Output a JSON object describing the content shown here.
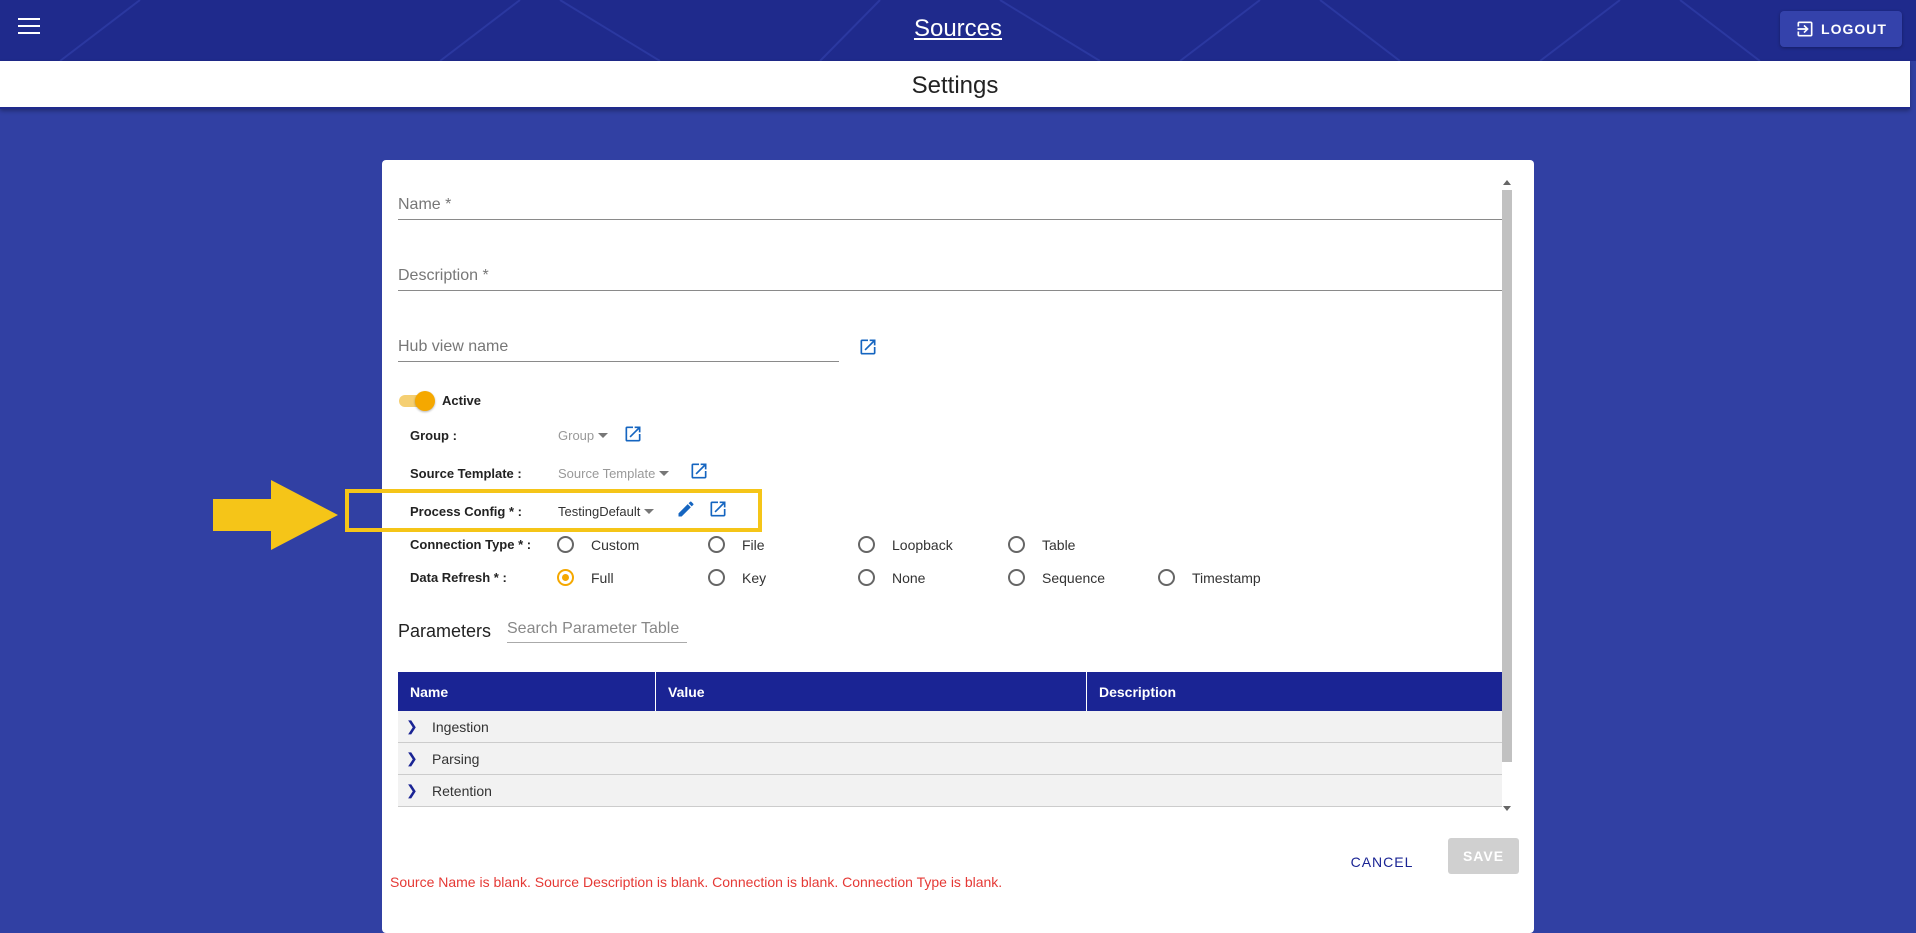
{
  "header": {
    "title": "Sources",
    "logout_label": "LOGOUT"
  },
  "page": {
    "title": "Settings"
  },
  "form": {
    "name_placeholder": "Name *",
    "description_placeholder": "Description *",
    "hub_view_placeholder": "Hub view name",
    "active_label": "Active",
    "active_on": true,
    "group_label": "Group :",
    "group_value": "Group",
    "source_template_label": "Source Template :",
    "source_template_value": "Source Template",
    "process_config_label": "Process Config * :",
    "process_config_value": "TestingDefault",
    "connection_type_label": "Connection Type * :",
    "connection_types": [
      "Custom",
      "File",
      "Loopback",
      "Table"
    ],
    "data_refresh_label": "Data Refresh * :",
    "data_refresh_options": [
      "Full",
      "Key",
      "None",
      "Sequence",
      "Timestamp"
    ],
    "data_refresh_selected": "Full"
  },
  "parameters": {
    "title": "Parameters",
    "search_placeholder": "Search Parameter Table",
    "columns": [
      "Name",
      "Value",
      "Description"
    ],
    "rows": [
      "Ingestion",
      "Parsing",
      "Retention"
    ]
  },
  "actions": {
    "cancel_label": "CANCEL",
    "save_label": "SAVE"
  },
  "error_message": "Source Name is blank. Source Description is blank. Connection is blank. Connection Type is blank.",
  "colors": {
    "header_bg": "#1f2a8c",
    "page_bg": "#3140a3",
    "accent": "#f5a800",
    "table_header": "#1a2494",
    "error": "#e53935"
  }
}
